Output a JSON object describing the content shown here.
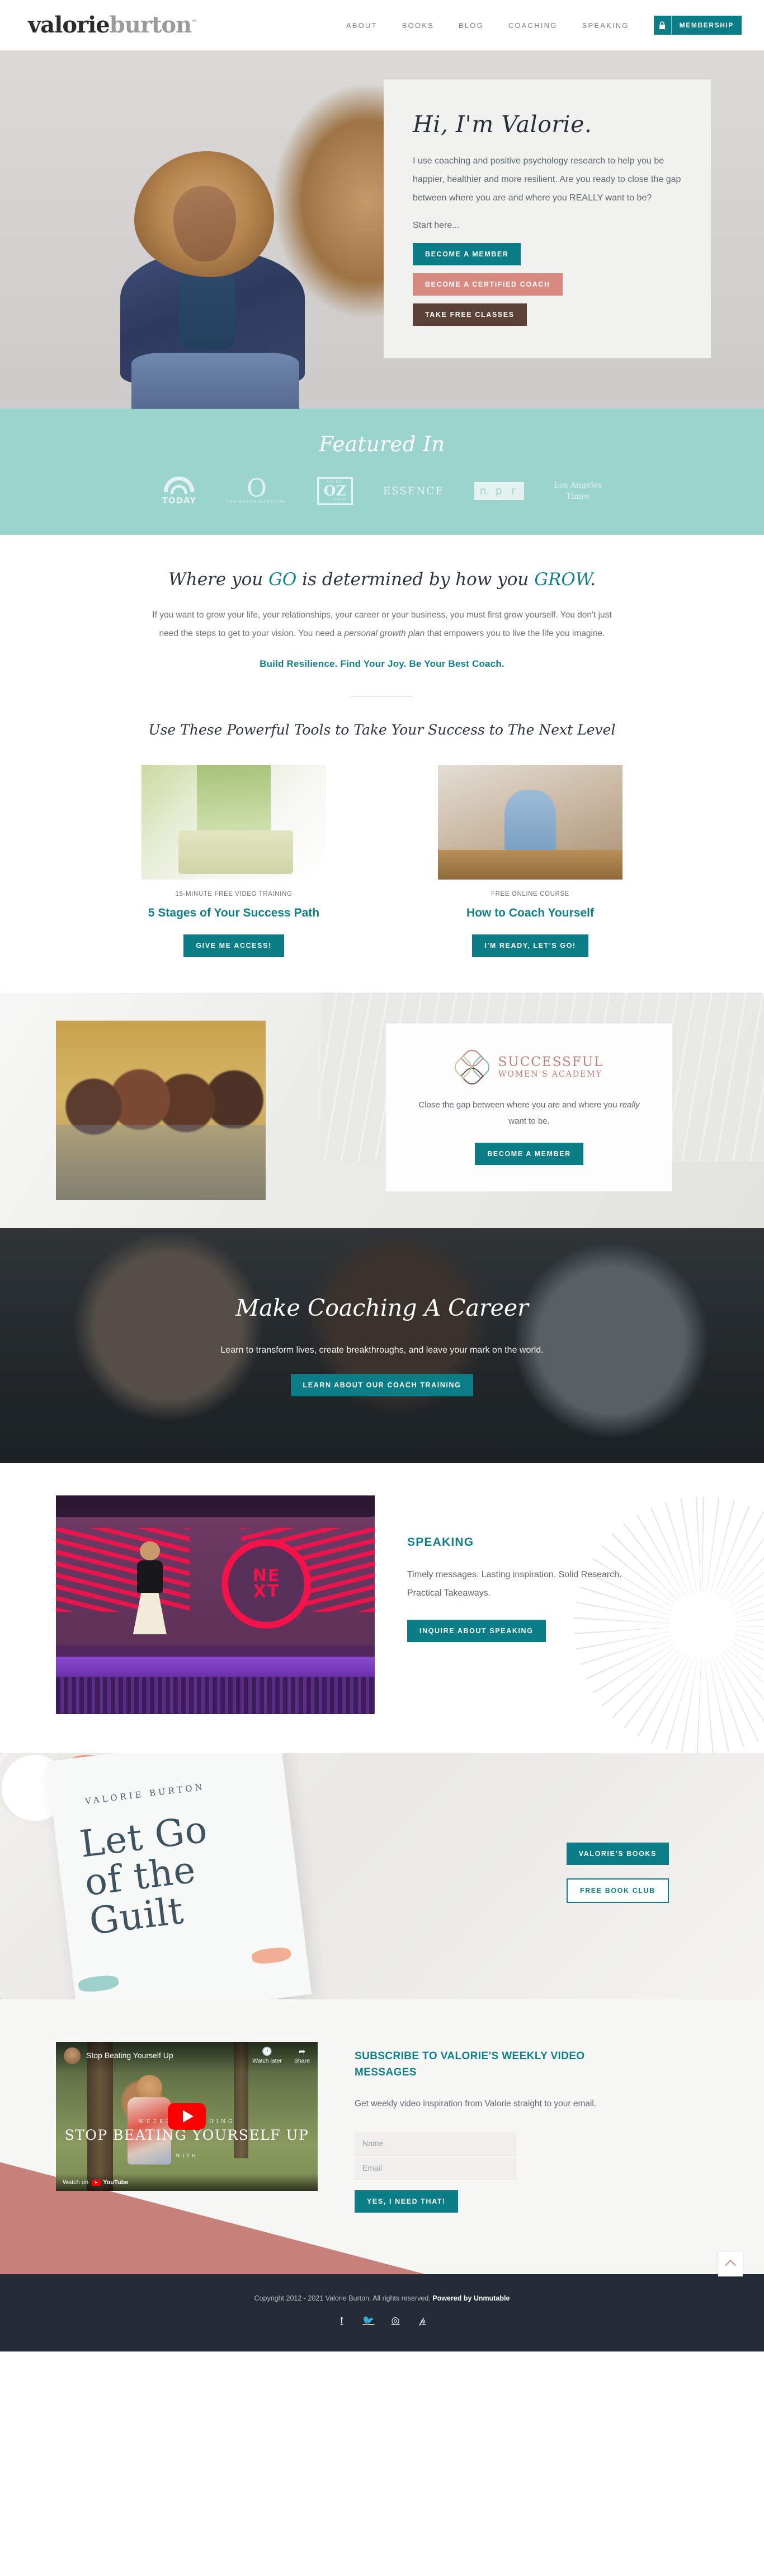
{
  "header": {
    "logo_first": "valorie",
    "logo_second": "burton",
    "logo_tm": "™",
    "nav": [
      {
        "label": "ABOUT"
      },
      {
        "label": "BOOKS"
      },
      {
        "label": "BLOG"
      },
      {
        "label": "COACHING"
      },
      {
        "label": "SPEAKING"
      }
    ],
    "membership_label": "MEMBERSHIP",
    "lock_icon": "lock-icon"
  },
  "hero": {
    "title": "Hi, I'm Valorie.",
    "body": "I use coaching and positive psychology research to help you be happier, healthier and more resilient. Are you ready to close the gap between where you are and where you REALLY want to be?",
    "start": "Start here...",
    "buttons": [
      {
        "label": "BECOME A MEMBER",
        "color": "#0a7d86"
      },
      {
        "label": "BECOME A CERTIFIED COACH",
        "color": "#d98a80"
      },
      {
        "label": "TAKE FREE CLASSES",
        "color": "#5b4237"
      }
    ]
  },
  "featured": {
    "title": "Featured In",
    "bg_color": "#9bd3cd",
    "logos": [
      {
        "name": "TODAY"
      },
      {
        "name": "O",
        "sub": "THE OPRAH MAGAZINE"
      },
      {
        "name": "OZ",
        "top": "THE DR.",
        "bottom": "SHOW"
      },
      {
        "name": "ESSENCE"
      },
      {
        "name": "n p r"
      },
      {
        "name": "Los Angeles",
        "sub": "Times"
      }
    ]
  },
  "grow": {
    "head_a": "Where you ",
    "head_go": "GO",
    "head_b": " is determined by how you ",
    "head_grow": "GROW",
    "head_c": ".",
    "body_a": "If you want to grow your life, your relationships, your career or your business, you must first grow yourself. You don't just need the steps to get to your vision. You need a ",
    "body_em": "personal growth plan",
    "body_b": " that empowers you to live the life you imagine.",
    "tagline": "Build Resilience. Find Your Joy. Be Your Best Coach."
  },
  "tools": {
    "head": "Use These Powerful Tools to Take Your Success to The Next Level",
    "items": [
      {
        "kicker": "15-MINUTE FREE VIDEO TRAINING",
        "title": "5 Stages of Your Success Path",
        "button": "GIVE ME ACCESS!"
      },
      {
        "kicker": "FREE ONLINE COURSE",
        "title": "How to Coach Yourself",
        "button": "I'M READY, LET'S GO!"
      }
    ]
  },
  "swa": {
    "brand_line1": "SUCCESSFUL",
    "brand_line2": "WOMEN'S ACADEMY",
    "text_a": "Close the gap between where you are and where you ",
    "text_em": "really",
    "text_b": " want to be.",
    "button": "BECOME A MEMBER"
  },
  "career": {
    "title": "Make Coaching A Career",
    "subtitle": "Learn to transform lives, create breakthroughs, and leave your mark on the world.",
    "button": "LEARN ABOUT OUR COACH TRAINING"
  },
  "speaking": {
    "kicker": "SPEAKING",
    "description": "Timely messages. Lasting inspiration. Solid Research. Practical Takeaways.",
    "button": "INQUIRE ABOUT SPEAKING",
    "stage_sign": "NE\nXT"
  },
  "book": {
    "author": "VALORIE BURTON",
    "title_l1": "Let Go",
    "title_l2": "of the",
    "title_l3": "Guilt",
    "buttons": [
      {
        "label": "VALORIE'S BOOKS",
        "style": "solid"
      },
      {
        "label": "FREE BOOK CLUB",
        "style": "outline"
      }
    ]
  },
  "subscribe": {
    "video": {
      "title": "Stop Beating Yourself Up",
      "watch_later": "Watch later",
      "share": "Share",
      "overlay_kicker": "WEEKLY COACHING",
      "overlay_title": "STOP BEATING YOURSELF UP",
      "overlay_with": "WITH",
      "watch_on": "Watch on",
      "youtube": "YouTube"
    },
    "heading": "SUBSCRIBE TO VALORIE'S WEEKLY VIDEO MESSAGES",
    "description": "Get weekly video inspiration from Valorie straight to your email.",
    "name_placeholder": "Name",
    "name_value": "",
    "email_placeholder": "Email",
    "email_value": "",
    "submit": "YES, I NEED THAT!"
  },
  "footer": {
    "copyright_a": "Copyright 2012 - 2021 Valorie Burton. All rights reserved. ",
    "copyright_b": "Powered by Unmutable",
    "social": [
      {
        "icon": "facebook-icon",
        "glyph": "f"
      },
      {
        "icon": "twitter-icon",
        "glyph": "🐦"
      },
      {
        "icon": "instagram-icon",
        "glyph": "◎"
      },
      {
        "icon": "pinterest-icon",
        "glyph": "𝓅"
      }
    ],
    "bg_color": "#222b36",
    "accent_color": "#c7817a"
  }
}
